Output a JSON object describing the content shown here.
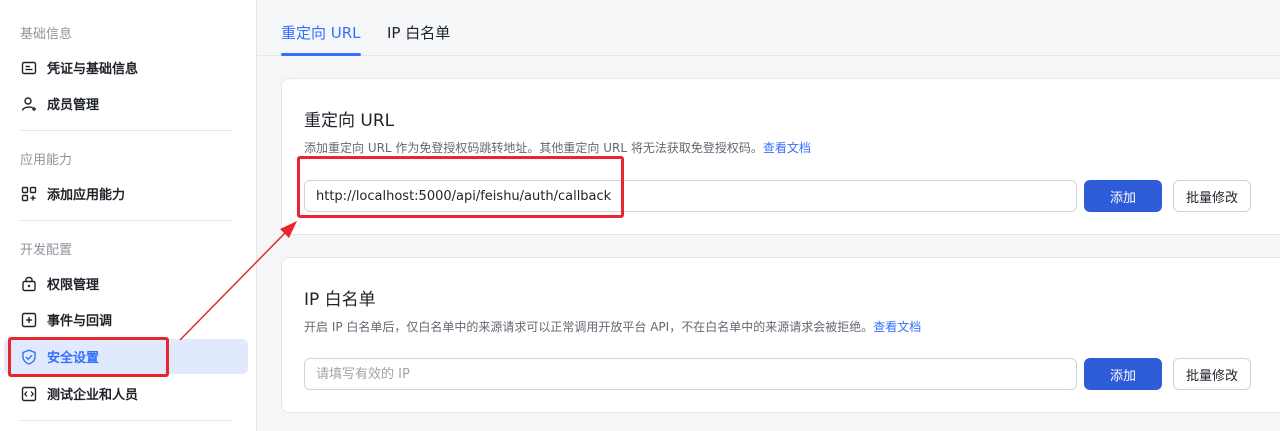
{
  "sidebar": {
    "groups": [
      {
        "title": "基础信息",
        "items": [
          {
            "label": "凭证与基础信息",
            "icon": "credential-icon"
          },
          {
            "label": "成员管理",
            "icon": "member-add-icon"
          }
        ]
      },
      {
        "title": "应用能力",
        "items": [
          {
            "label": "添加应用能力",
            "icon": "grid-add-icon"
          }
        ]
      },
      {
        "title": "开发配置",
        "items": [
          {
            "label": "权限管理",
            "icon": "lock-icon"
          },
          {
            "label": "事件与回调",
            "icon": "plus-box-icon"
          },
          {
            "label": "安全设置",
            "icon": "shield-check-icon",
            "active": true
          },
          {
            "label": "测试企业和人员",
            "icon": "code-box-icon"
          }
        ]
      }
    ]
  },
  "tabs": [
    {
      "label": "重定向 URL",
      "active": true
    },
    {
      "label": "IP 白名单",
      "active": false
    }
  ],
  "redirect": {
    "title": "重定向 URL",
    "desc": "添加重定向 URL 作为免登授权码跳转地址。其他重定向 URL 将无法获取免登授权码。",
    "doc_link": "查看文档",
    "value": "http://localhost:5000/api/feishu/auth/callback",
    "add_label": "添加",
    "batch_label": "批量修改"
  },
  "ip": {
    "title": "IP 白名单",
    "desc": "开启 IP 白名单后，仅白名单中的来源请求可以正常调用开放平台 API，不在白名单中的来源请求会被拒绝。",
    "doc_link": "查看文档",
    "placeholder": "请填写有效的 IP",
    "add_label": "添加",
    "batch_label": "批量修改"
  },
  "colors": {
    "accent": "#3370ff",
    "primary_button": "#2e5bd8",
    "annotation": "#e8262e"
  }
}
